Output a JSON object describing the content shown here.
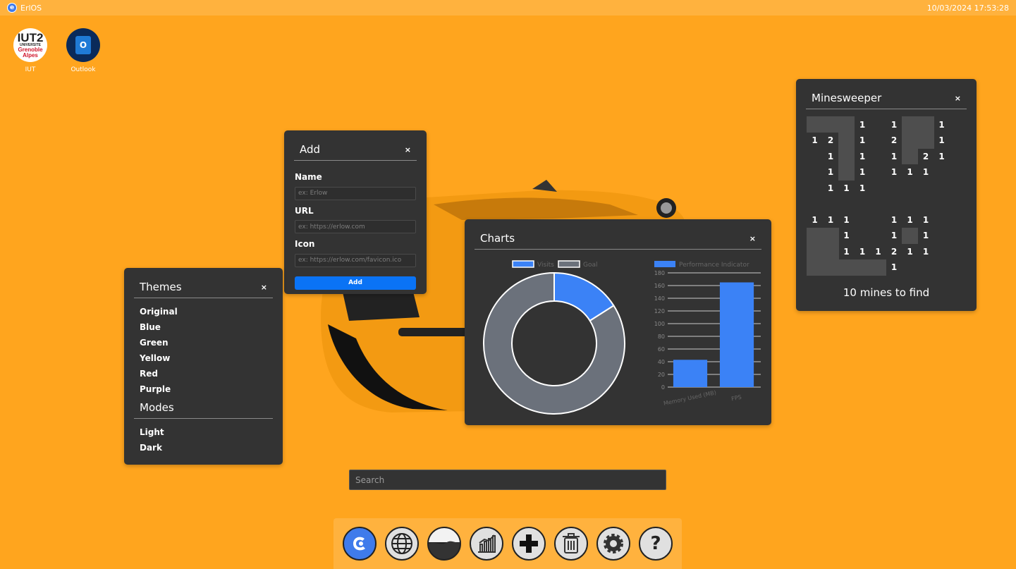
{
  "topbar": {
    "os_name": "ErlOS",
    "datetime": "10/03/2024 17:53:28"
  },
  "desktop": {
    "icons": [
      {
        "label": "IUT",
        "logo_text": [
          "IUT2",
          "UNIVERSITE",
          "Grenoble",
          "Alpes"
        ]
      },
      {
        "label": "Outlook"
      }
    ]
  },
  "add_window": {
    "title": "Add",
    "close": "×",
    "name_label": "Name",
    "name_placeholder": "ex: Erlow",
    "url_label": "URL",
    "url_placeholder": "ex: https://erlow.com",
    "icon_label": "Icon",
    "icon_placeholder": "ex: https://erlow.com/favicon.ico",
    "submit_label": "Add",
    "accent": "#0A73F5"
  },
  "themes_window": {
    "title": "Themes",
    "close": "×",
    "themes": [
      "Original",
      "Blue",
      "Green",
      "Yellow",
      "Red",
      "Purple"
    ],
    "modes_title": "Modes",
    "modes": [
      "Light",
      "Dark"
    ]
  },
  "charts_window": {
    "title": "Charts",
    "close": "×"
  },
  "chart_data": [
    {
      "type": "pie",
      "variant": "doughnut",
      "title": "",
      "legend": [
        "Visits",
        "Goal"
      ],
      "legend_placement": "top",
      "values": [
        16,
        84
      ],
      "colors": [
        "#3B82F6",
        "#6B717B"
      ]
    },
    {
      "type": "bar",
      "title": "",
      "legend": [
        "Performance Indicator"
      ],
      "legend_placement": "top",
      "categories": [
        "Memory Used (MB)",
        "FPS"
      ],
      "series": [
        {
          "name": "Performance Indicator",
          "values": [
            43,
            165
          ]
        }
      ],
      "ylim": [
        0,
        180
      ],
      "yticks": [
        0,
        20,
        40,
        60,
        80,
        100,
        120,
        140,
        160,
        180
      ],
      "grid": true,
      "color": "#3B82F6"
    }
  ],
  "minesweeper": {
    "title": "Minesweeper",
    "close": "×",
    "status": "10 mines to find",
    "grid": [
      [
        "#",
        "#",
        "#",
        "1",
        "",
        "1",
        "#",
        "#",
        "1"
      ],
      [
        "1",
        "2",
        "#",
        "1",
        "",
        "2",
        "#",
        "#",
        "1"
      ],
      [
        "",
        "1",
        "#",
        "1",
        "",
        "1",
        "#",
        "2",
        "1"
      ],
      [
        "",
        "1",
        "#",
        "1",
        "",
        "1",
        "1",
        "1",
        ""
      ],
      [
        "",
        "1",
        "1",
        "1",
        "",
        "",
        "",
        "",
        ""
      ],
      [
        "",
        "",
        "",
        "",
        "",
        "",
        "",
        "",
        ""
      ],
      [
        "1",
        "1",
        "1",
        "",
        "",
        "1",
        "1",
        "1",
        ""
      ],
      [
        "#",
        "#",
        "1",
        "",
        "",
        "1",
        "#",
        "1",
        ""
      ],
      [
        "#",
        "#",
        "1",
        "1",
        "1",
        "2",
        "1",
        "1",
        ""
      ],
      [
        "#",
        "#",
        "#",
        "#",
        "#",
        "1",
        "",
        "",
        ""
      ]
    ]
  },
  "search": {
    "placeholder": "Search"
  },
  "dock": {
    "items": [
      "erlos-icon",
      "globe-icon",
      "wallpaper-icon",
      "chart-icon",
      "add-icon",
      "trash-icon",
      "settings-icon",
      "help-icon"
    ]
  },
  "colors": {
    "background": "#FFA51E",
    "window": "#333333",
    "accent_blue": "#3B82F6"
  }
}
